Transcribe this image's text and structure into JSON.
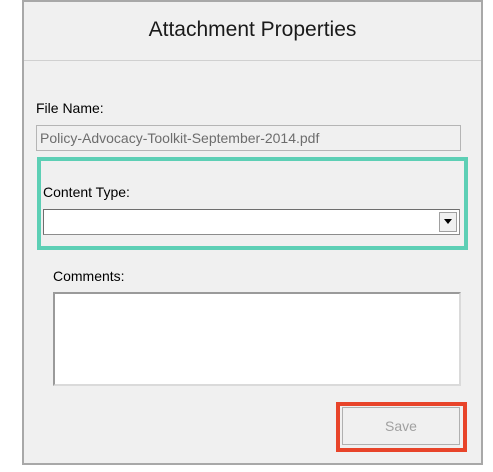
{
  "dialog": {
    "title": "Attachment Properties"
  },
  "file_name": {
    "label": "File Name:",
    "value": "Policy-Advocacy-Toolkit-September-2014.pdf"
  },
  "content_type": {
    "label": "Content Type:",
    "selected_value": "",
    "dropdown_icon": "chevron-down-icon"
  },
  "comments": {
    "label": "Comments:",
    "value": ""
  },
  "save_button": {
    "label": "Save",
    "enabled": false
  },
  "highlights": {
    "content_type_color": "#5dcfb5",
    "save_button_color": "#e8442a"
  }
}
